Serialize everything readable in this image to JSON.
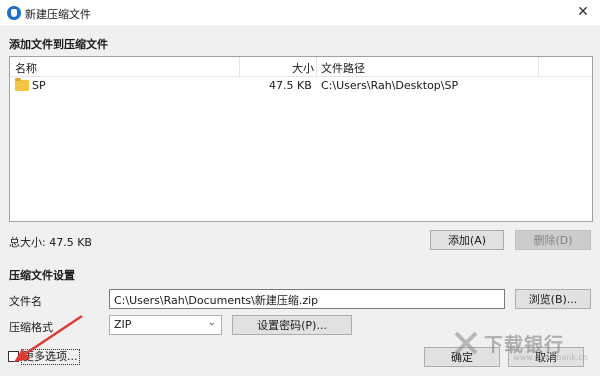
{
  "window": {
    "title": "新建压缩文件",
    "close_glyph": "✕"
  },
  "add_section": {
    "title": "添加文件到压缩文件"
  },
  "file_list": {
    "columns": [
      "名称",
      "大小",
      "文件路径"
    ],
    "rows": [
      {
        "name": "SP",
        "size": "47.5 KB",
        "path": "C:\\Users\\Rah\\Desktop\\SP",
        "icon": "folder-icon"
      }
    ]
  },
  "total_size": "总大小: 47.5 KB",
  "buttons": {
    "add": "添加(A)",
    "delete": "删除(D)",
    "browse": "浏览(B)...",
    "set_password": "设置密码(P)...",
    "confirm": "确定",
    "cancel": "取消"
  },
  "settings_section": {
    "title": "压缩文件设置"
  },
  "filename_label": "文件名",
  "filename_value": "C:\\Users\\Rah\\Documents\\新建压缩.zip",
  "format_label": "压缩格式",
  "format_value": "ZIP",
  "more_options_label": "更多选项...",
  "more_options_checked": false,
  "watermark": {
    "text": "下载银行",
    "sub": "www.downbank.cn"
  },
  "colors": {
    "annotation_arrow": "#e03a2f",
    "folder": "#f4c542",
    "accent": "#1b6fd0"
  }
}
